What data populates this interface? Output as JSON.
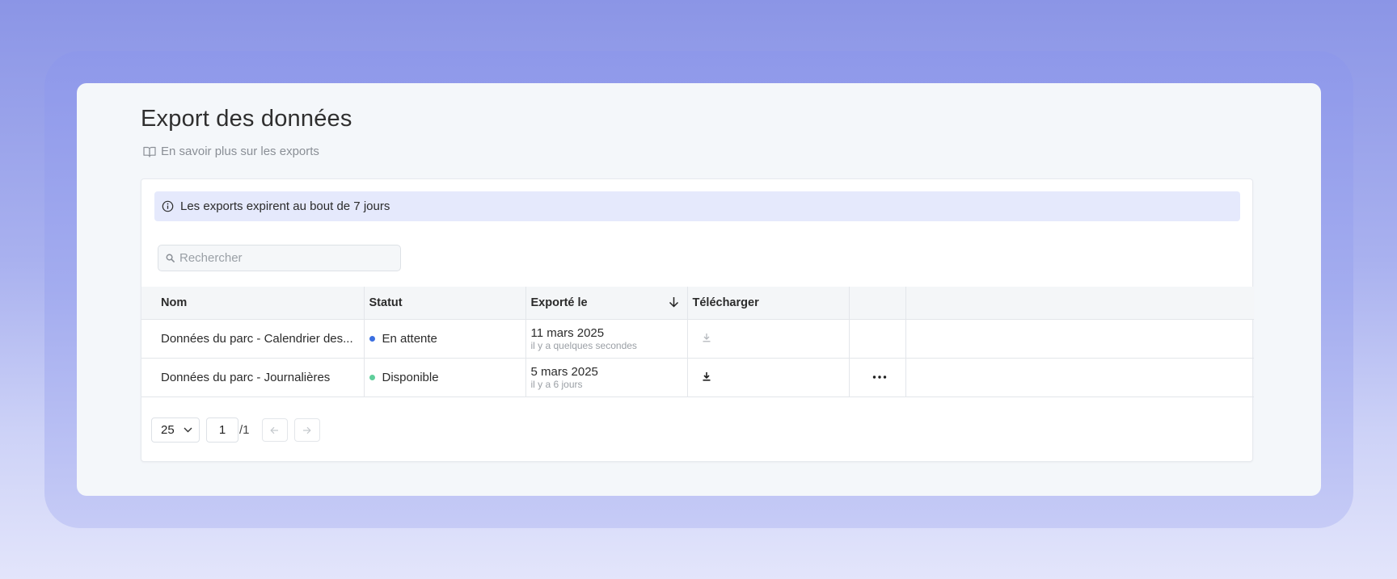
{
  "page": {
    "title": "Export des données",
    "learn_more": "En savoir plus sur les exports"
  },
  "banner": {
    "text": "Les exports expirent au bout de 7 jours"
  },
  "search": {
    "placeholder": "Rechercher"
  },
  "table": {
    "columns": {
      "name": "Nom",
      "status": "Statut",
      "exported": "Exporté le",
      "download": "Télécharger"
    },
    "rows": [
      {
        "name": "Données du parc - Calendrier des...",
        "status": "En attente",
        "status_color": "#3b6fe0",
        "date": "11 mars 2025",
        "relative": "il y a quelques secondes",
        "download_enabled": false,
        "has_menu": false
      },
      {
        "name": "Données du parc - Journalières",
        "status": "Disponible",
        "status_color": "#5fce9b",
        "date": "5 mars 2025",
        "relative": "il y a 6 jours",
        "download_enabled": true,
        "has_menu": true
      }
    ]
  },
  "pagination": {
    "page_size": "25",
    "current_page": "1",
    "total_pages": "/1"
  },
  "colors": {
    "background_top": "#8b95e6",
    "window": "#f4f7fa",
    "banner": "#e5e9fc"
  }
}
